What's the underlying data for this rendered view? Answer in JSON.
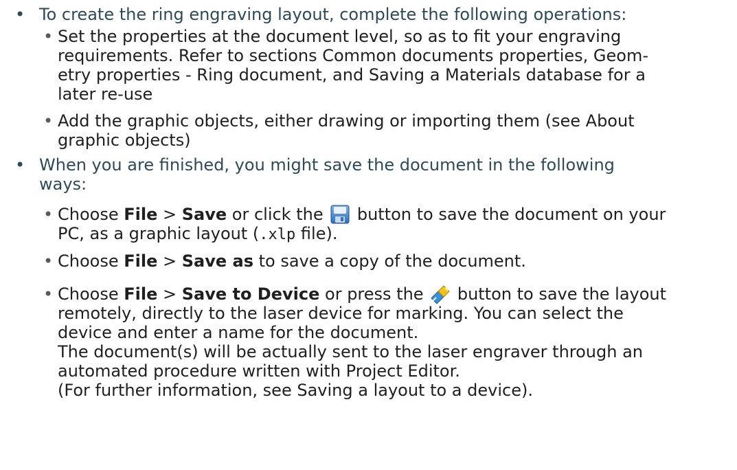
{
  "bullet_glyph": "•",
  "sub_bullet_glyph": "•",
  "item1": {
    "text": "To create the ring engraving layout, complete the following operations:",
    "sub": [
      {
        "line1": "Set the properties at the document level, so as to fit your engraving",
        "line2": "requirements. Refer to sections Common documents properties, Geom-",
        "line3": "etry properties - Ring document, and Saving a Materials database for a",
        "line4": "later re-use"
      },
      {
        "line1": "Add the graphic objects, either drawing or importing them (see About",
        "line2": "graphic objects)"
      }
    ]
  },
  "item2": {
    "line1": "When you are finished, you might save the document in the following",
    "line2": "ways:",
    "sub": [
      {
        "choose": "Choose ",
        "menu_file": "File",
        "sep": " > ",
        "menu_cmd": "Save",
        "mid": " or click the ",
        "icon": "floppy-disk-icon",
        "after": " button to save the document on your",
        "line2_pre": "PC, as a graphic layout (",
        "ext": ".xlp",
        "line2_post": " file)."
      },
      {
        "choose": "Choose ",
        "menu_file": "File",
        "sep": " > ",
        "menu_cmd": "Save as",
        "after": " to save a copy of the document."
      },
      {
        "choose": "Choose ",
        "menu_file": "File",
        "sep": " > ",
        "menu_cmd": "Save to Device",
        "mid": " or press the ",
        "icon": "save-to-device-icon",
        "after": " button to save the layout",
        "line2": "remotely, directly to the laser device for marking. You can select the",
        "line3": "device and enter a name for the document.",
        "line4": "The document(s) will be actually sent to the laser engraver through an",
        "line5": "automated procedure written with Project Editor.",
        "line6": "(For further information, see Saving a layout to a device)."
      }
    ]
  }
}
